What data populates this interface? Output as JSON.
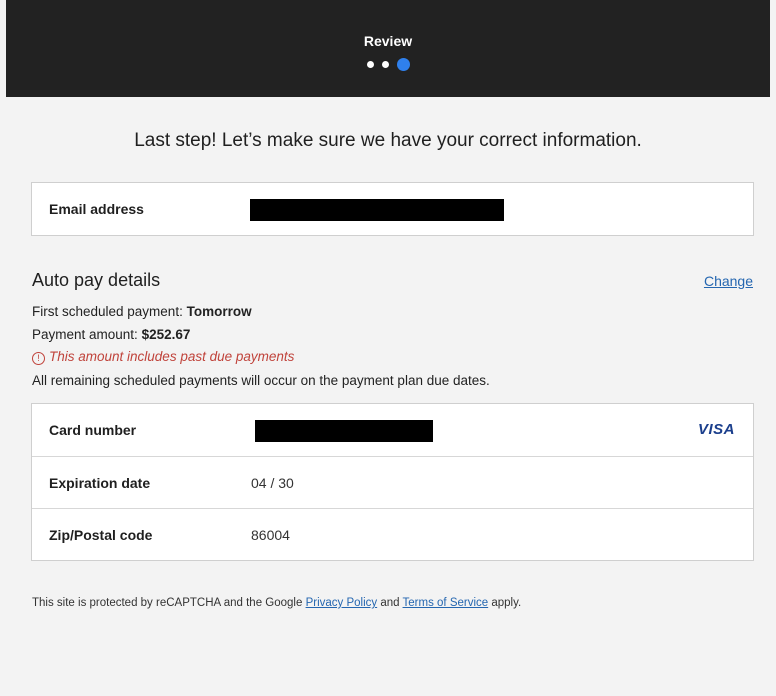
{
  "header": {
    "title": "Review",
    "steps_total": 3,
    "current_step": 3,
    "step_active_color": "#2f80ed"
  },
  "heading": "Last step! Let’s make sure we have your correct information.",
  "email_card": {
    "label": "Email address",
    "value_redacted": true
  },
  "autopay": {
    "title": "Auto pay details",
    "change_label": "Change",
    "first_payment_prefix": "First scheduled payment: ",
    "first_payment_value": "Tomorrow",
    "amount_prefix": "Payment amount: ",
    "amount_value": "$252.67",
    "warning_icon": "!",
    "warning_text": "This amount includes past due payments",
    "remaining_note": "All remaining scheduled payments will occur on the payment plan due dates."
  },
  "card_details": {
    "card_number_label": "Card number",
    "card_number_redacted": true,
    "card_brand": "VISA",
    "expiration_label": "Expiration date",
    "expiration_value": "04 / 30",
    "zip_label": "Zip/Postal code",
    "zip_value": "86004"
  },
  "footer": {
    "text_before": "This site is protected by reCAPTCHA and the Google ",
    "privacy_label": "Privacy Policy",
    "text_middle": " and ",
    "terms_label": "Terms of Service",
    "text_after": " apply."
  },
  "colors": {
    "header_bg": "#222222",
    "link": "#2466b0",
    "warning": "#c0433b",
    "visa": "#1a3e8c"
  }
}
